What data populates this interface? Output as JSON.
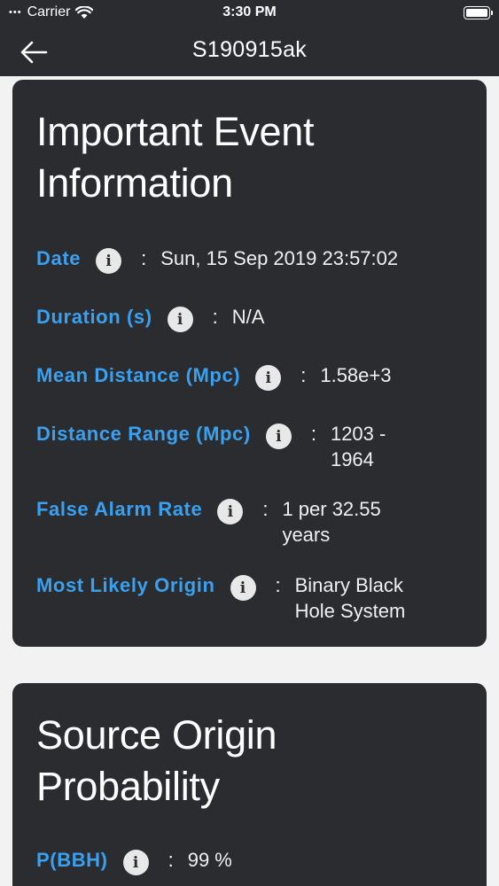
{
  "status_bar": {
    "carrier": "Carrier",
    "time": "3:30 PM"
  },
  "nav": {
    "title": "S190915ak",
    "back_icon": "arrow-left-icon"
  },
  "event_card": {
    "title": "Important Event Information",
    "rows": [
      {
        "label": "Date",
        "value": "Sun, 15 Sep 2019 23:57:02"
      },
      {
        "label": "Duration (s)",
        "value": "N/A"
      },
      {
        "label": "Mean Distance (Mpc)",
        "value": "1.58e+3"
      },
      {
        "label": "Distance Range (Mpc)",
        "value": "1203 - 1964"
      },
      {
        "label": "False Alarm Rate",
        "value": "1 per 32.55 years"
      },
      {
        "label": "Most Likely Origin",
        "value": "Binary Black Hole System"
      }
    ]
  },
  "probability_card": {
    "title": "Source Origin Probability",
    "rows": [
      {
        "label": "P(BBH)",
        "value": "99 %"
      }
    ]
  },
  "info_glyph": "i",
  "colon": ":",
  "colors": {
    "accent": "#3aa0f0",
    "card": "#2b2c30",
    "background": "#f2f2f2"
  }
}
